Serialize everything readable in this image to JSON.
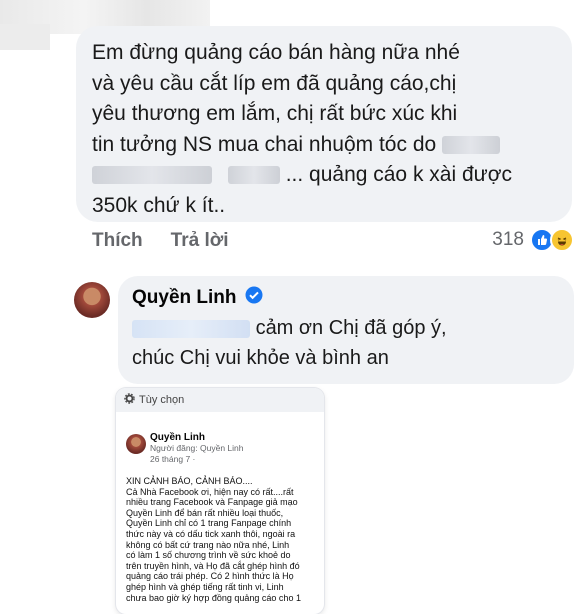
{
  "comment": {
    "lines": [
      "Em đừng quảng cáo bán hàng nữa nhé",
      "và yêu cầu cắt líp em đã quảng cáo,chị",
      "yêu thương em lắm, chị rất bức xúc khi",
      "tin tưởng NS mua chai nhuộm tóc do",
      "... quảng cáo k xài được",
      "350k chứ k ít.."
    ],
    "actions": {
      "like": "Thích",
      "reply": "Trả lời"
    },
    "reaction_count": "318",
    "reaction_icons": [
      "like-icon",
      "haha-icon"
    ]
  },
  "reply": {
    "author": "Quyền Linh",
    "verified_icon": "verified-badge-icon",
    "line1": "cảm ơn Chị đã góp ý,",
    "line2": "chúc Chị vui khỏe và bình an"
  },
  "attached_screenshot": {
    "options_label": "Tùy chọn",
    "author": "Quyền Linh",
    "meta_line1": "Người đăng: Quyền Linh",
    "meta_line2": "26 tháng 7 ·",
    "body_lines": [
      "XIN CẢNH BÁO, CẢNH BÁO....",
      "  Cả Nhà Facebook ơi, hiện nay có rất....rất",
      "nhiều trang Facebook và Fanpage giả mạo",
      "Quyền Linh để bán rất nhiều loại thuốc,",
      "Quyền Linh chỉ có 1 trang Fanpage chính",
      "thức này và có dấu tick xanh thôi, ngoài ra",
      "không có bất cứ trang nào nữa nhé, Linh",
      "có làm 1 số chương trình về sức khoẻ do",
      "trên truyền hình, và Họ đã cắt ghép hình đó",
      "quảng cáo trái phép. Có 2 hình thức là Họ",
      "ghép hình và ghép tiếng rất tinh vi, Linh",
      "chưa bao giờ ký hợp đồng quảng cáo cho 1"
    ]
  },
  "colors": {
    "bubble": "#f0f2f5",
    "accent": "#1877f2",
    "muted": "#65676b"
  }
}
